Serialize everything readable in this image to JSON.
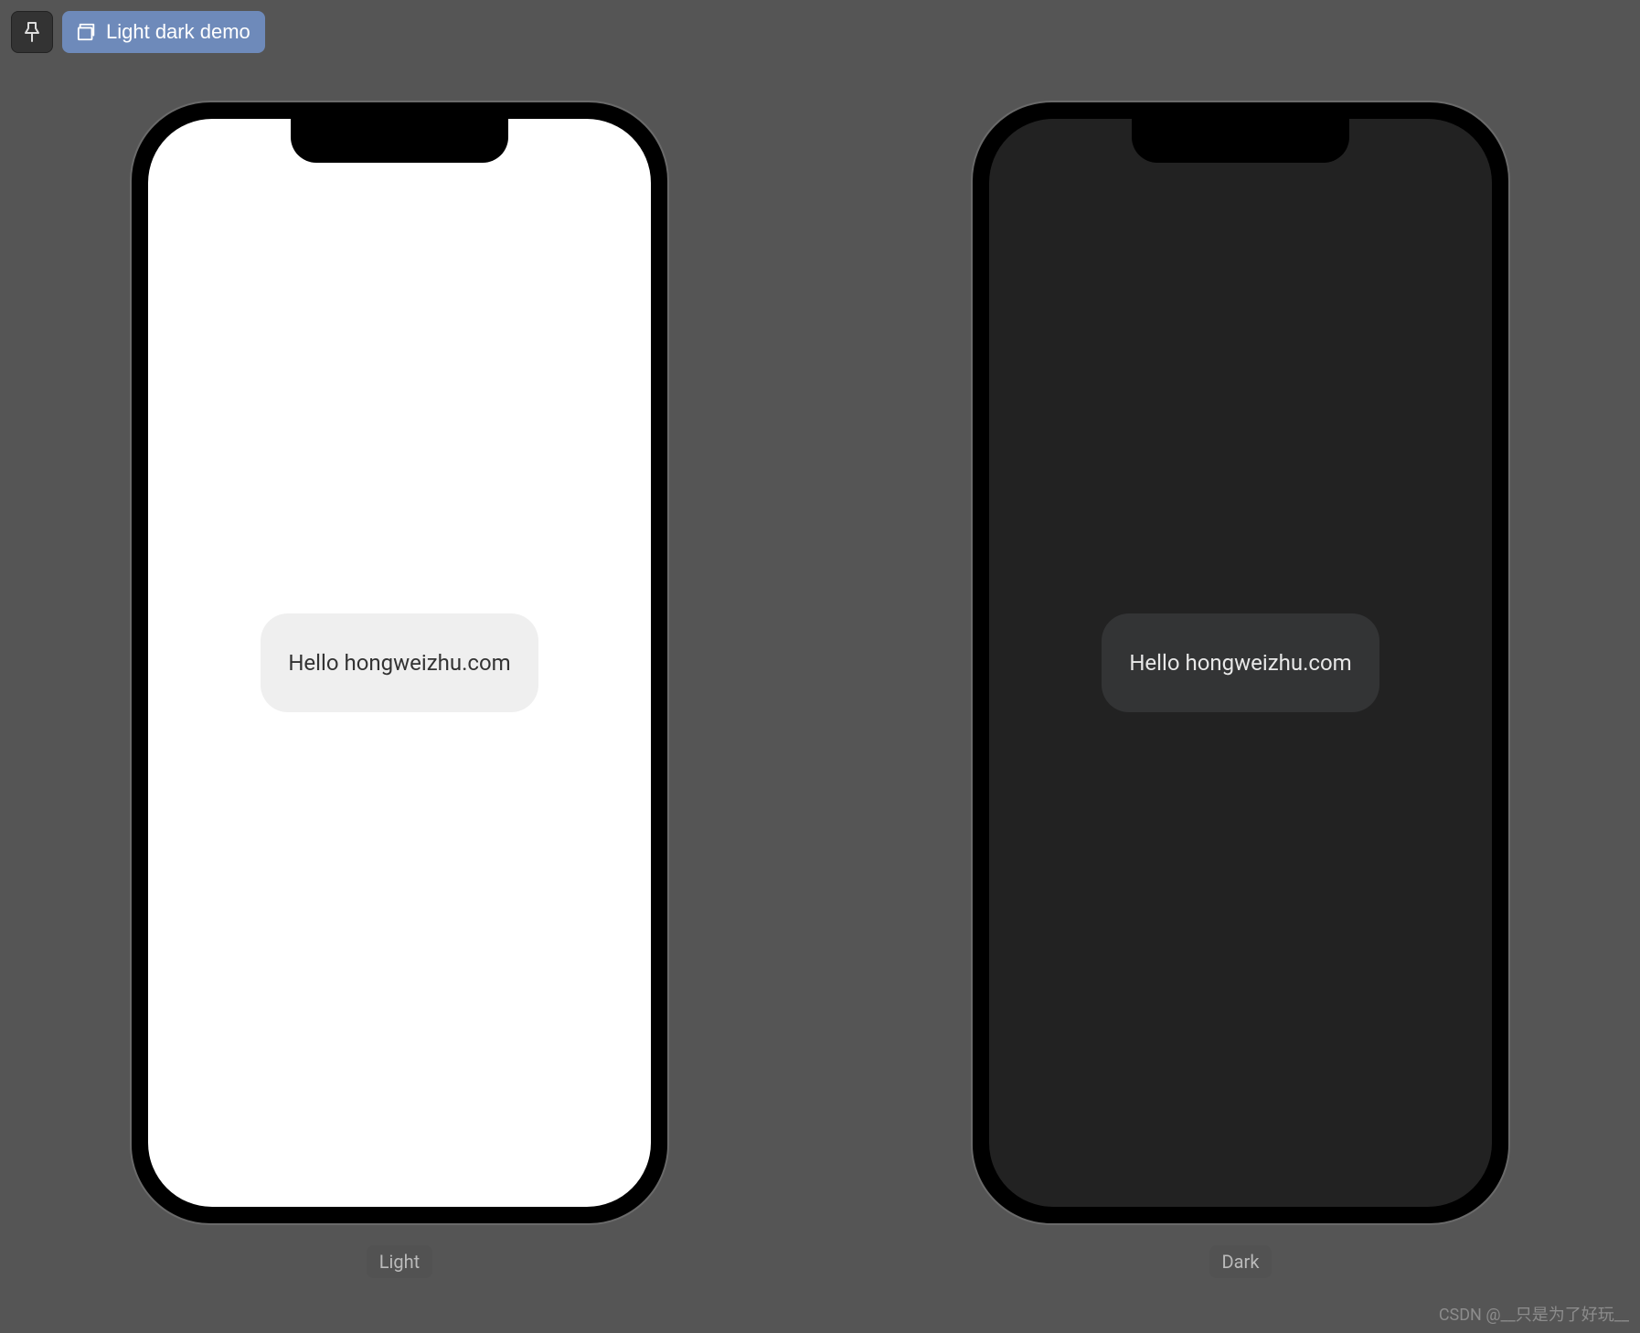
{
  "toolbar": {
    "title": "Light dark demo"
  },
  "previews": [
    {
      "theme": "light",
      "card_text": "Hello hongweizhu.com",
      "label": "Light"
    },
    {
      "theme": "dark",
      "card_text": "Hello hongweizhu.com",
      "label": "Dark"
    }
  ],
  "watermark": "CSDN @__只是为了好玩__"
}
